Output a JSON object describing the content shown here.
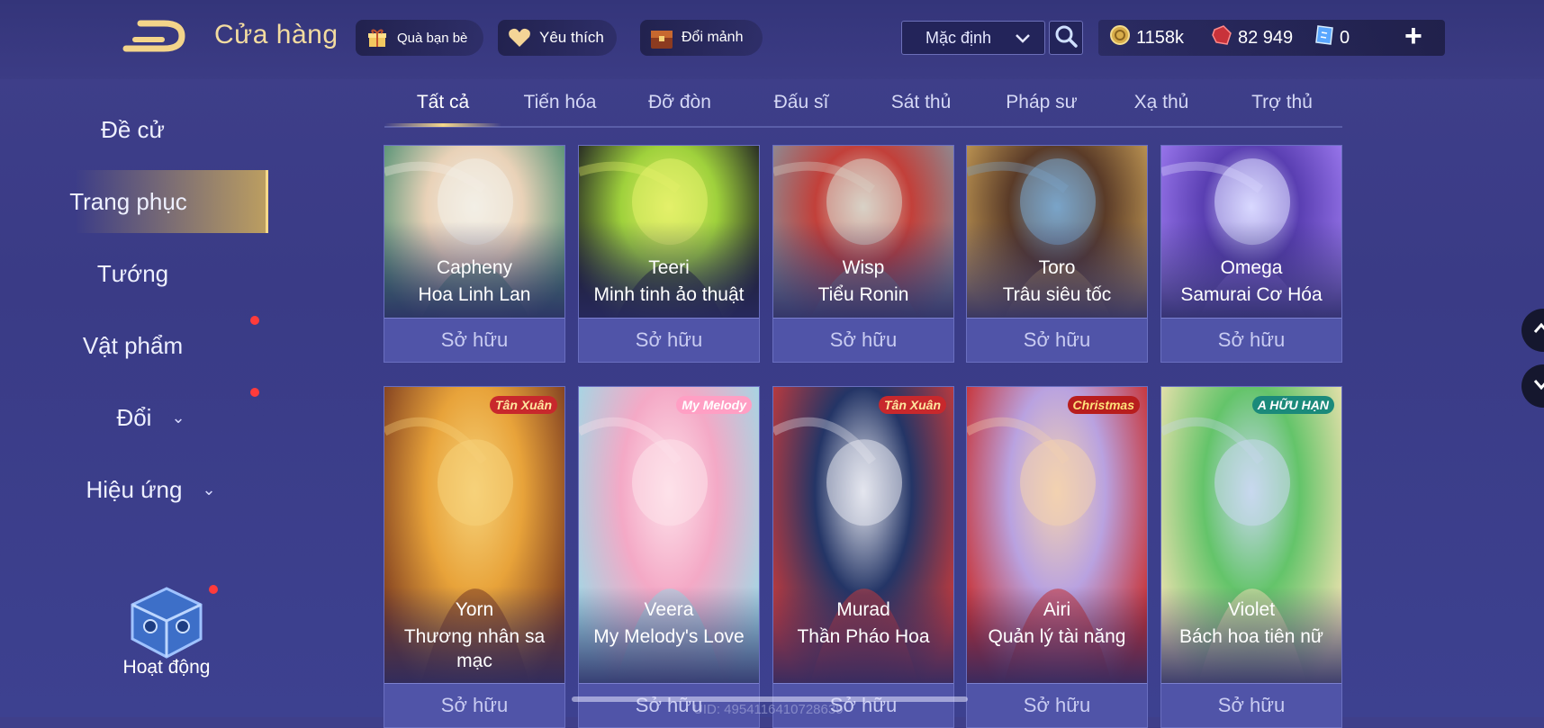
{
  "header": {
    "title": "Cửa hàng",
    "buttons": [
      {
        "label": "Quà bạn bè",
        "icon": "gift-icon"
      },
      {
        "label": "Yêu thích",
        "icon": "heart-icon"
      },
      {
        "label": "Đổi mảnh",
        "icon": "shard-chest-icon"
      }
    ],
    "sort_value": "Mặc định",
    "currencies": [
      {
        "value": "1158k",
        "icon": "gold-coin-icon"
      },
      {
        "value": "82 949",
        "icon": "red-gem-icon"
      },
      {
        "value": "0",
        "icon": "voucher-icon"
      }
    ],
    "plus_label": "+"
  },
  "sidebar": {
    "items": [
      {
        "label": "Đề cử"
      },
      {
        "label": "Trang phục",
        "active": true
      },
      {
        "label": "Tướng"
      },
      {
        "label": "Vật phẩm",
        "dot": true
      },
      {
        "label": "Đổi",
        "dot": true,
        "expand": true
      },
      {
        "label": "Hiệu ứng",
        "expand": true
      }
    ],
    "activity_label": "Hoạt động"
  },
  "tabs": [
    "Tất cả",
    "Tiến hóa",
    "Đỡ đòn",
    "Đấu sĩ",
    "Sát thủ",
    "Pháp sư",
    "Xạ thủ",
    "Trợ thủ"
  ],
  "cards_row1": [
    {
      "hero": "Capheny",
      "skin": "Hoa Linh Lan",
      "status": "Sở hữu",
      "colors": [
        "#e9d2b8",
        "#4e8f72",
        "#f3efe6"
      ]
    },
    {
      "hero": "Teeri",
      "skin": "Minh tinh ảo thuật",
      "status": "Sở hữu",
      "colors": [
        "#9fd13c",
        "#1c1c22",
        "#e4f06a"
      ]
    },
    {
      "hero": "Wisp",
      "skin": "Tiểu Ronin",
      "status": "Sở hữu",
      "colors": [
        "#c2403a",
        "#8a8f98",
        "#d9d2c6"
      ]
    },
    {
      "hero": "Toro",
      "skin": "Trâu siêu tốc",
      "status": "Sở hữu",
      "colors": [
        "#5a3b28",
        "#c39a55",
        "#7aa4c8"
      ]
    },
    {
      "hero": "Omega",
      "skin": "Samurai Cơ Hóa",
      "status": "Sở hữu",
      "colors": [
        "#5a3fb2",
        "#9d7af0",
        "#d9d8ff"
      ]
    }
  ],
  "cards_row2": [
    {
      "hero": "Yorn",
      "skin": "Thương nhân sa mạc",
      "status": "Sở hữu",
      "badge": "Tân Xuân",
      "colors": [
        "#e8a33a",
        "#7b3a1f",
        "#f6d27a"
      ]
    },
    {
      "hero": "Veera",
      "skin": "My Melody's Love",
      "status": "Sở hữu",
      "badge": "My Melody",
      "colors": [
        "#f4a9c6",
        "#9fd9e6",
        "#fde1ea"
      ]
    },
    {
      "hero": "Murad",
      "skin": "Thần Pháo Hoa",
      "status": "Sở hữu",
      "badge": "Tân Xuân",
      "colors": [
        "#243566",
        "#c73a3a",
        "#e4e6ee"
      ]
    },
    {
      "hero": "Airi",
      "skin": "Quản lý tài năng",
      "status": "Sở hữu",
      "badge": "Christmas",
      "colors": [
        "#b9a2e0",
        "#c92d2d",
        "#f3d2b0"
      ]
    },
    {
      "hero": "Violet",
      "skin": "Bách hoa tiên nữ",
      "status": "Sở hữu",
      "badge": "A HỮU HẠN",
      "colors": [
        "#64c46a",
        "#f0e2b0",
        "#c8d8ef"
      ]
    }
  ],
  "uid_text": "UID: 4954116410728639",
  "accent": "#f6d98a"
}
